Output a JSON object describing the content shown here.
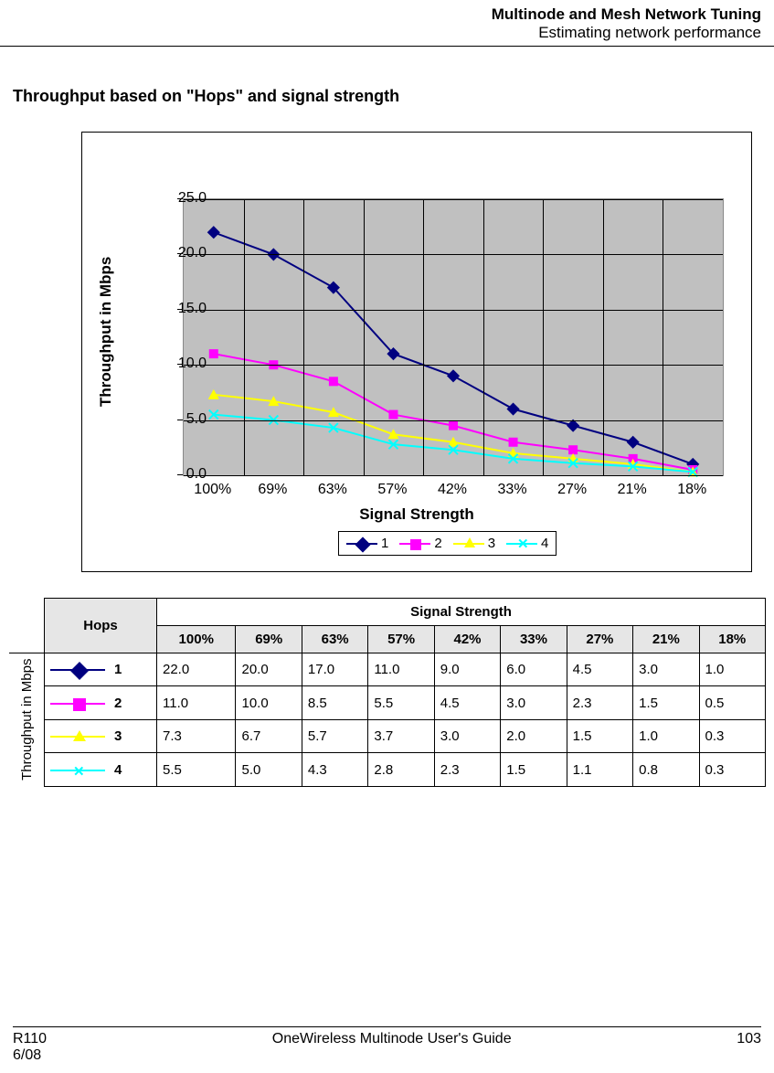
{
  "header": {
    "line1": "Multinode and Mesh Network Tuning",
    "line2": "Estimating network performance"
  },
  "section_title": "Throughput based on \"Hops\" and signal strength",
  "footer": {
    "left1": "R110",
    "left2": "6/08",
    "center": "OneWireless Multinode User's Guide",
    "right": "103"
  },
  "table": {
    "hops_label": "Hops",
    "ss_label": "Signal Strength",
    "row_vert_label": "Throughput in\nMbps"
  },
  "chart_data": {
    "type": "line",
    "title": "",
    "xlabel": "Signal Strength",
    "ylabel": "Throughput in Mbps",
    "ylim": [
      0.0,
      25.0
    ],
    "yticks": [
      0.0,
      5.0,
      10.0,
      15.0,
      20.0,
      25.0
    ],
    "categories": [
      "100%",
      "69%",
      "63%",
      "57%",
      "42%",
      "33%",
      "27%",
      "21%",
      "18%"
    ],
    "legend_position": "bottom",
    "grid": true,
    "series": [
      {
        "name": "1",
        "color": "#000080",
        "marker": "diamond",
        "values": [
          22.0,
          20.0,
          17.0,
          11.0,
          9.0,
          6.0,
          4.5,
          3.0,
          1.0
        ]
      },
      {
        "name": "2",
        "color": "#ff00ff",
        "marker": "square",
        "values": [
          11.0,
          10.0,
          8.5,
          5.5,
          4.5,
          3.0,
          2.3,
          1.5,
          0.5
        ]
      },
      {
        "name": "3",
        "color": "#ffff00",
        "marker": "triangle",
        "values": [
          7.3,
          6.7,
          5.7,
          3.7,
          3.0,
          2.0,
          1.5,
          1.0,
          0.3
        ]
      },
      {
        "name": "4",
        "color": "#00ffff",
        "marker": "x",
        "values": [
          5.5,
          5.0,
          4.3,
          2.8,
          2.3,
          1.5,
          1.1,
          0.8,
          0.3
        ]
      }
    ]
  }
}
